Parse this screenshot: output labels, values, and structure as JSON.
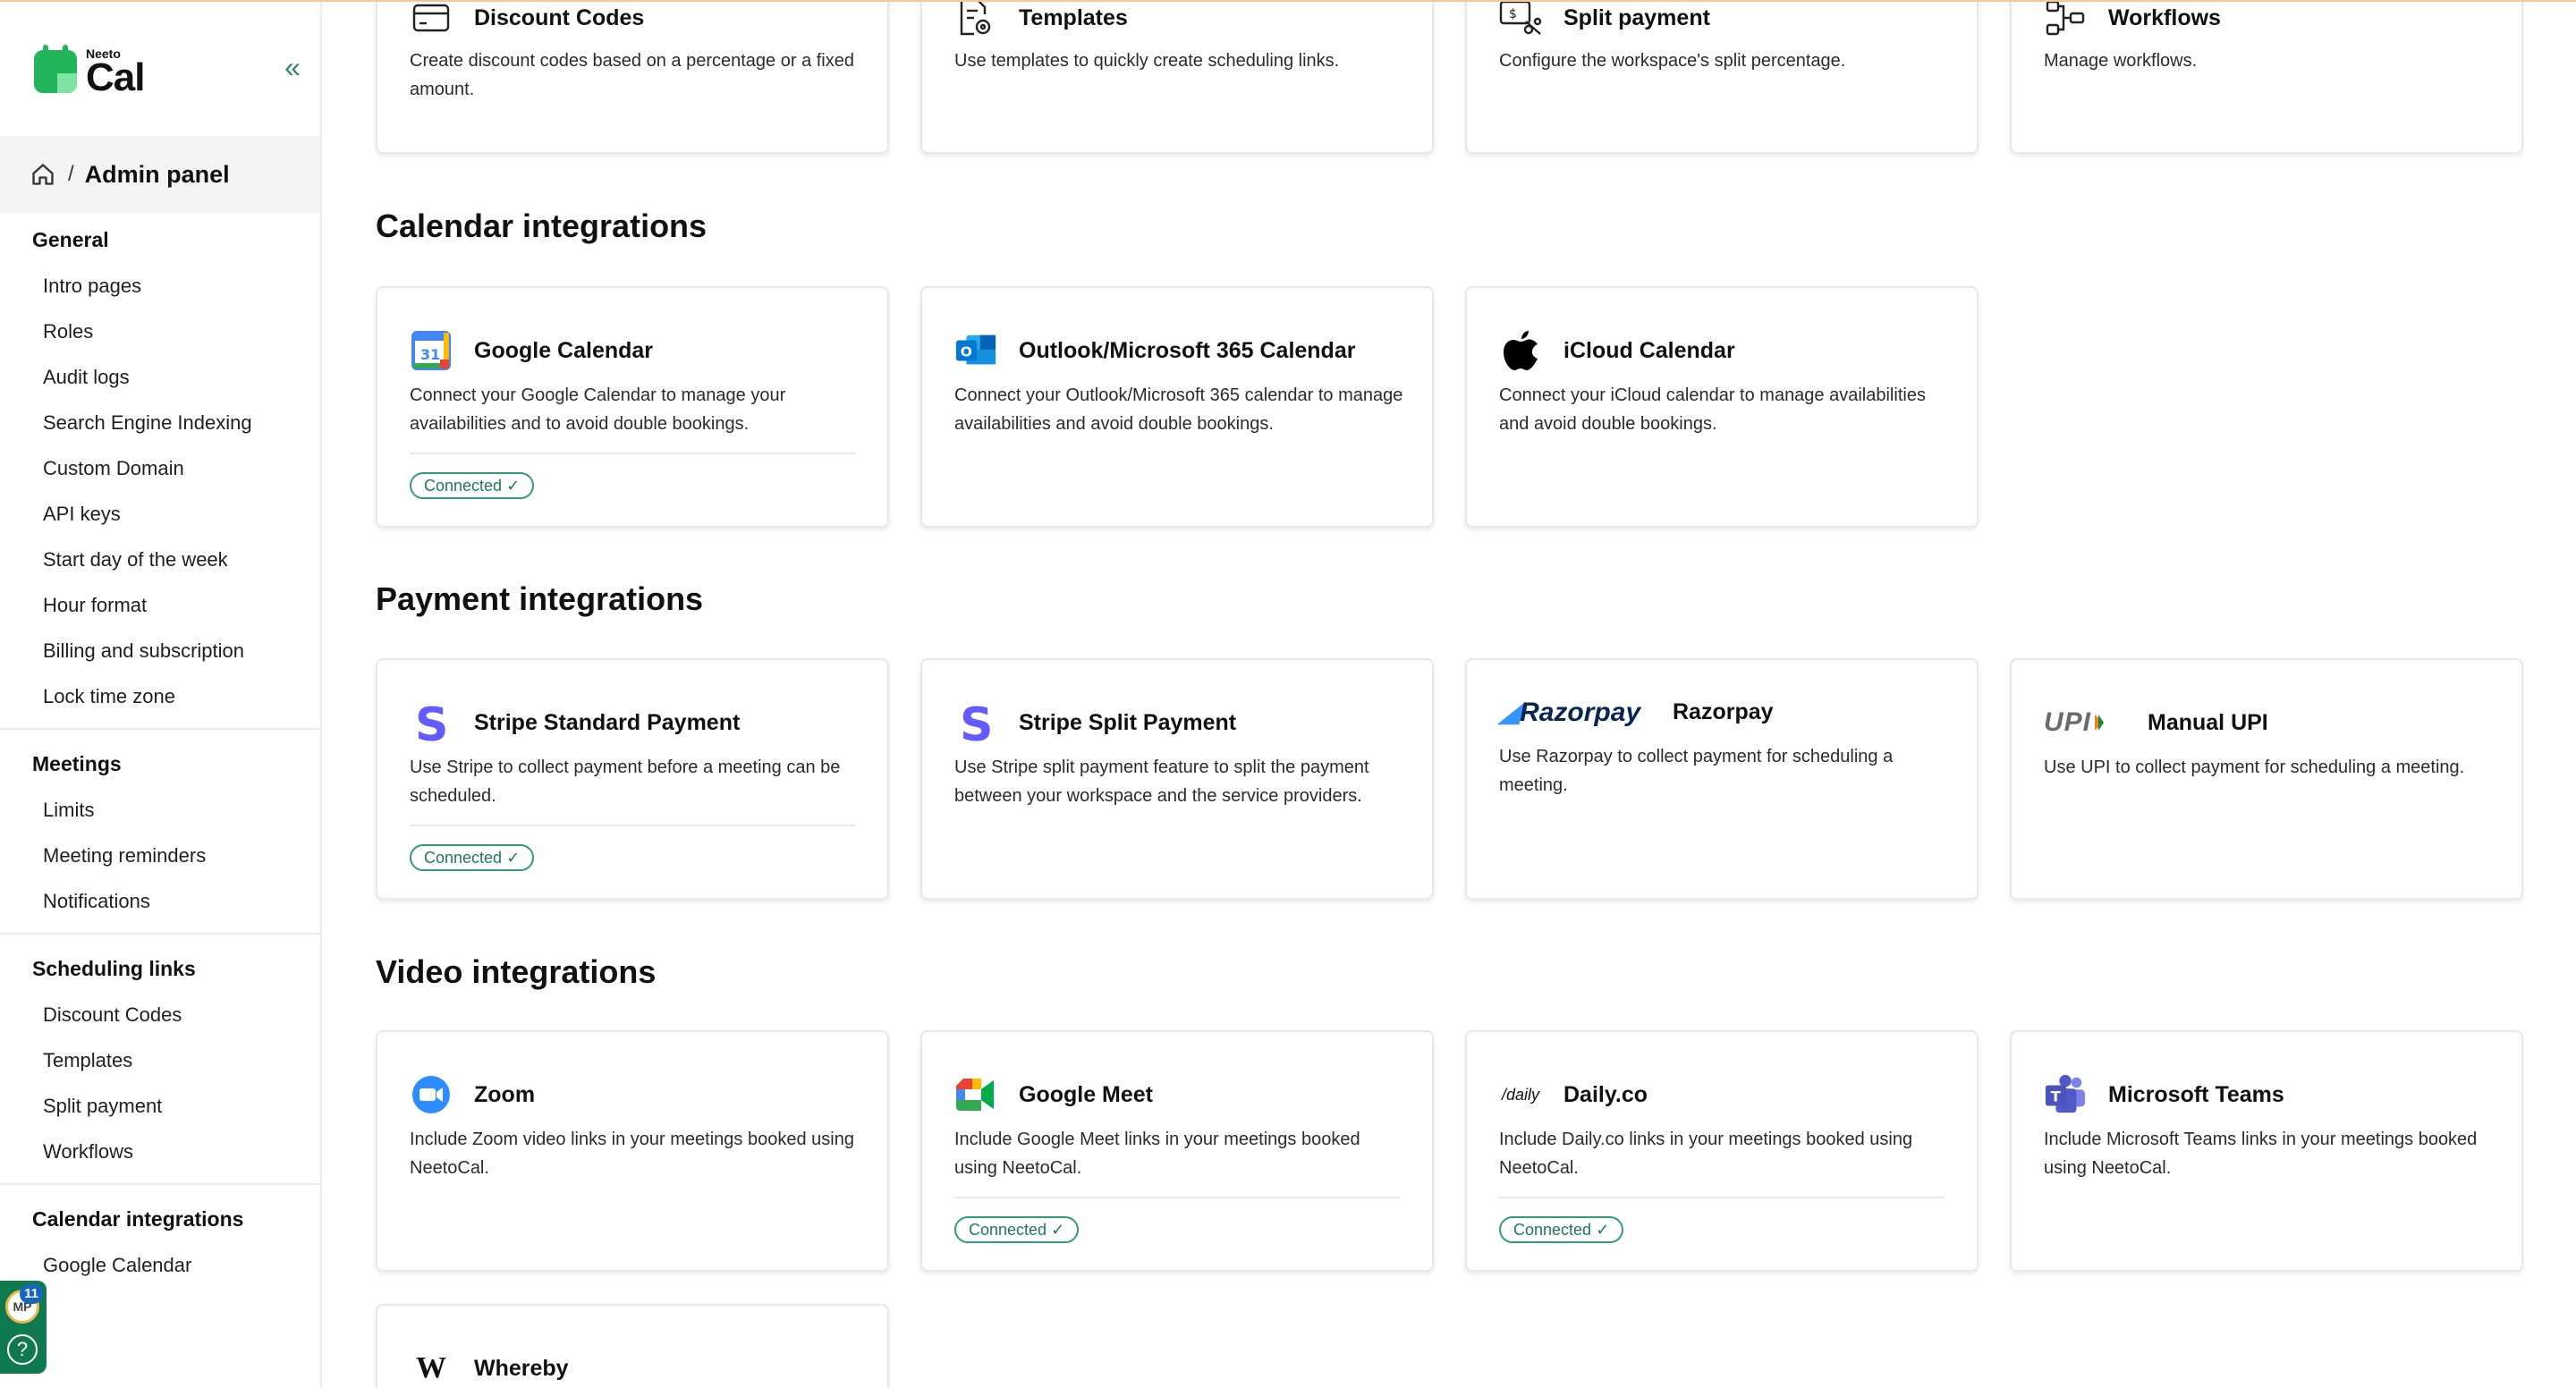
{
  "app": {
    "logo_small": "Neeto",
    "logo_big": "Cal"
  },
  "breadcrumb": {
    "separator": "/",
    "title": "Admin panel"
  },
  "sidebar": {
    "groups": [
      {
        "heading": "General",
        "items": [
          "Intro pages",
          "Roles",
          "Audit logs",
          "Search Engine Indexing",
          "Custom Domain",
          "API keys",
          "Start day of the week",
          "Hour format",
          "Billing and subscription",
          "Lock time zone"
        ]
      },
      {
        "heading": "Meetings",
        "items": [
          "Limits",
          "Meeting reminders",
          "Notifications"
        ]
      },
      {
        "heading": "Scheduling links",
        "items": [
          "Discount Codes",
          "Templates",
          "Split payment",
          "Workflows"
        ]
      },
      {
        "heading": "Calendar integrations",
        "items": [
          "Google Calendar"
        ]
      }
    ]
  },
  "help_widget": {
    "avatar_initials": "MP",
    "badge_count": "11",
    "help_symbol": "?"
  },
  "top_cards": [
    {
      "title": "Discount Codes",
      "desc": "Create discount codes based on a percentage or a fixed amount.",
      "icon": "discount-card-icon"
    },
    {
      "title": "Templates",
      "desc": "Use templates to quickly create scheduling links.",
      "icon": "template-icon"
    },
    {
      "title": "Split payment",
      "desc": "Configure the workspace's split percentage.",
      "icon": "split-payment-icon"
    },
    {
      "title": "Workflows",
      "desc": "Manage workflows.",
      "icon": "workflow-icon"
    }
  ],
  "sections": {
    "calendar": {
      "title": "Calendar integrations",
      "cards": [
        {
          "title": "Google Calendar",
          "desc": "Connect your Google Calendar to manage your availabilities and to avoid double bookings.",
          "status": "Connected ✓",
          "icon": "google-calendar-icon"
        },
        {
          "title": "Outlook/Microsoft 365 Calendar",
          "desc": "Connect your Outlook/Microsoft 365 calendar to manage availabilities and avoid double bookings.",
          "icon": "outlook-icon"
        },
        {
          "title": "iCloud Calendar",
          "desc": "Connect your iCloud calendar to manage availabilities and avoid double bookings.",
          "icon": "apple-icon"
        }
      ]
    },
    "payment": {
      "title": "Payment integrations",
      "cards": [
        {
          "title": "Stripe Standard Payment",
          "desc": "Use Stripe to collect payment before a meeting can be scheduled.",
          "status": "Connected ✓",
          "icon": "stripe-icon"
        },
        {
          "title": "Stripe Split Payment",
          "desc": "Use Stripe split payment feature to split the payment between your workspace and the service providers.",
          "icon": "stripe-icon"
        },
        {
          "title": "Razorpay",
          "logo_text": "Razorpay",
          "desc": "Use Razorpay to collect payment for scheduling a meeting.",
          "icon": "razorpay-logo"
        },
        {
          "title": "Manual UPI",
          "logo_text": "UPI",
          "desc": "Use UPI to collect payment for scheduling a meeting.",
          "icon": "upi-logo"
        }
      ]
    },
    "video": {
      "title": "Video integrations",
      "cards": [
        {
          "title": "Zoom",
          "desc": "Include Zoom video links in your meetings booked using NeetoCal.",
          "icon": "zoom-icon"
        },
        {
          "title": "Google Meet",
          "desc": "Include Google Meet links in your meetings booked using NeetoCal.",
          "status": "Connected ✓",
          "icon": "google-meet-icon"
        },
        {
          "title": "Daily.co",
          "logo_text": "daily",
          "desc": "Include Daily.co links in your meetings booked using NeetoCal.",
          "status": "Connected ✓",
          "icon": "daily-logo"
        },
        {
          "title": "Microsoft Teams",
          "desc": "Include Microsoft Teams links in your meetings booked using NeetoCal.",
          "icon": "teams-icon"
        },
        {
          "title": "Whereby",
          "logo_text": "W",
          "icon": "whereby-icon"
        }
      ]
    }
  },
  "colors": {
    "brand_green": "#22b55a",
    "connected_border": "#2f9e6b",
    "collapse": "#2b8a5c"
  }
}
